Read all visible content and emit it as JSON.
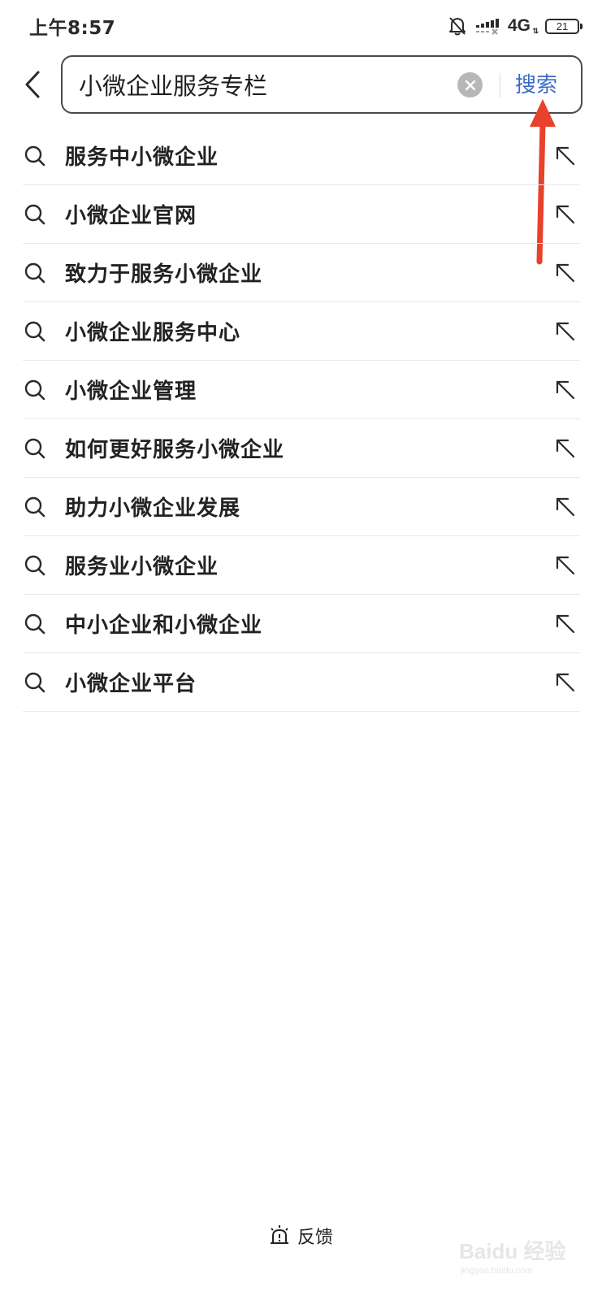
{
  "status_bar": {
    "time": "上午8:57",
    "network": "4G",
    "battery": "21",
    "icons": [
      "mute-bell-icon",
      "signal-icon",
      "network-arrows-icon",
      "battery-icon"
    ]
  },
  "header": {
    "back_icon": "chevron-left-icon",
    "search": {
      "value": "小微企业服务专栏",
      "clear_icon": "clear-circle-icon",
      "button_label": "搜索"
    }
  },
  "suggestions": [
    {
      "text": "服务中小微企业"
    },
    {
      "text": "小微企业官网"
    },
    {
      "text": "致力于服务小微企业"
    },
    {
      "text": "小微企业服务中心"
    },
    {
      "text": "小微企业管理"
    },
    {
      "text": "如何更好服务小微企业"
    },
    {
      "text": "助力小微企业发展"
    },
    {
      "text": "服务业小微企业"
    },
    {
      "text": "中小企业和小微企业"
    },
    {
      "text": "小微企业平台"
    }
  ],
  "feedback": {
    "label": "反馈",
    "icon": "feedback-alarm-icon"
  },
  "watermark": {
    "main": "Baidu 经验",
    "sub": "jingyan.baidu.com"
  },
  "colors": {
    "accent": "#3b69c8",
    "annotation": "#e8412c",
    "text": "#222222",
    "divider": "#e8e8e8"
  }
}
